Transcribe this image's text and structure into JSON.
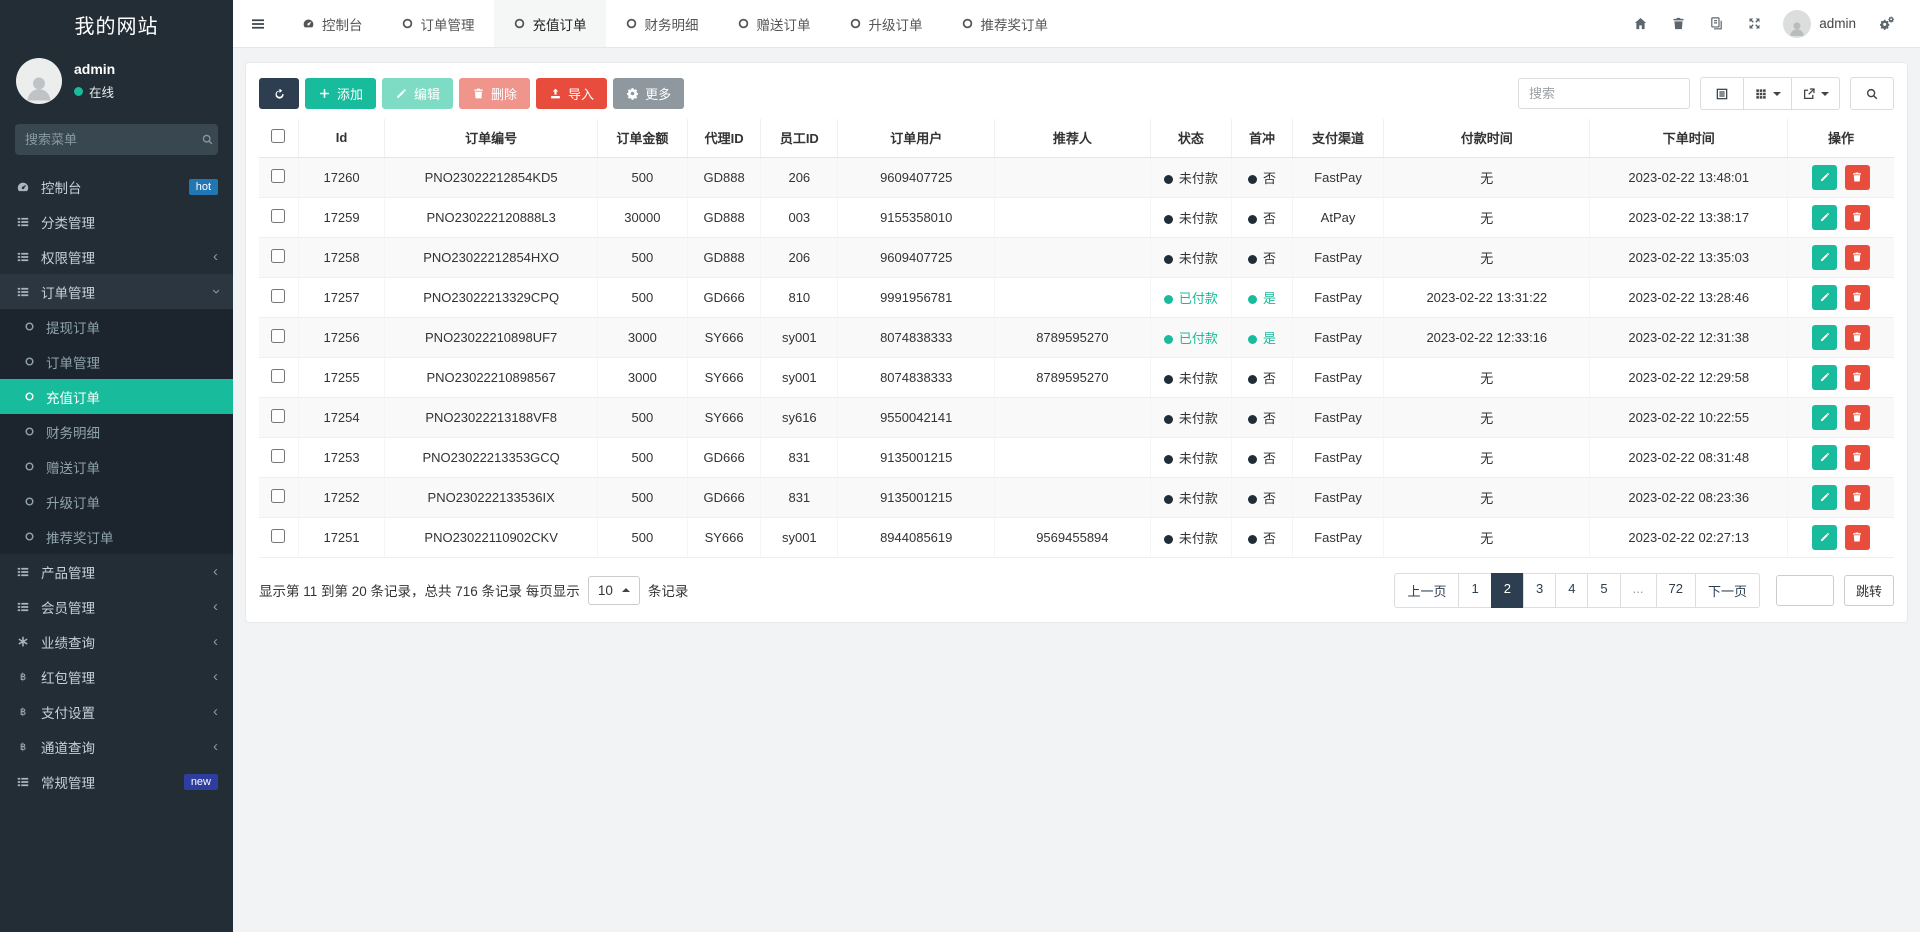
{
  "app": {
    "title": "我的网站"
  },
  "sidebar": {
    "user": {
      "name": "admin",
      "status": "在线"
    },
    "search_placeholder": "搜索菜单",
    "items": [
      {
        "label": "控制台",
        "icon": "gauge",
        "badge": "hot"
      },
      {
        "label": "分类管理",
        "icon": "list"
      },
      {
        "label": "权限管理",
        "icon": "list",
        "chevron": "left"
      },
      {
        "label": "订单管理",
        "icon": "list",
        "chevron": "down",
        "expanded": true,
        "children": [
          {
            "label": "提现订单"
          },
          {
            "label": "订单管理"
          },
          {
            "label": "充值订单",
            "active": true
          },
          {
            "label": "财务明细"
          },
          {
            "label": "赠送订单"
          },
          {
            "label": "升级订单"
          },
          {
            "label": "推荐奖订单"
          }
        ]
      },
      {
        "label": "产品管理",
        "icon": "list",
        "chevron": "left"
      },
      {
        "label": "会员管理",
        "icon": "list",
        "chevron": "left"
      },
      {
        "label": "业绩查询",
        "icon": "asterisk",
        "chevron": "left"
      },
      {
        "label": "红包管理",
        "icon": "baht",
        "chevron": "left"
      },
      {
        "label": "支付设置",
        "icon": "baht",
        "chevron": "left"
      },
      {
        "label": "通道查询",
        "icon": "baht",
        "chevron": "left"
      },
      {
        "label": "常规管理",
        "icon": "list",
        "badge": "new"
      }
    ]
  },
  "topnav": {
    "tabs": [
      {
        "label": "控制台",
        "icon": "gauge"
      },
      {
        "label": "订单管理",
        "icon": "ring"
      },
      {
        "label": "充值订单",
        "icon": "ring",
        "active": true
      },
      {
        "label": "财务明细",
        "icon": "ring"
      },
      {
        "label": "赠送订单",
        "icon": "ring"
      },
      {
        "label": "升级订单",
        "icon": "ring"
      },
      {
        "label": "推荐奖订单",
        "icon": "ring"
      }
    ],
    "right_icons": [
      {
        "name": "home-icon",
        "icon": "home"
      },
      {
        "name": "trash-icon",
        "icon": "trash"
      },
      {
        "name": "copy-icon",
        "icon": "copy"
      },
      {
        "name": "fullscreen-icon",
        "icon": "expand"
      }
    ],
    "user": "admin"
  },
  "toolbar": {
    "buttons": [
      {
        "label": "",
        "icon": "refresh",
        "variant": "dark",
        "name": "refresh-button"
      },
      {
        "label": "添加",
        "icon": "plus",
        "variant": "success",
        "name": "add-button"
      },
      {
        "label": "编辑",
        "icon": "pencil",
        "variant": "success-muted",
        "name": "edit-button"
      },
      {
        "label": "删除",
        "icon": "trash",
        "variant": "danger-muted",
        "name": "delete-button"
      },
      {
        "label": "导入",
        "icon": "upload",
        "variant": "danger",
        "name": "import-button"
      },
      {
        "label": "更多",
        "icon": "gear",
        "variant": "secondary",
        "name": "more-button"
      }
    ],
    "search_placeholder": "搜索",
    "view_buttons": [
      {
        "name": "toggle-view-button",
        "icon": "listview"
      },
      {
        "name": "columns-button",
        "icon": "grid",
        "caret": true
      },
      {
        "name": "export-button",
        "icon": "export",
        "caret": true
      }
    ]
  },
  "table": {
    "headers": [
      "Id",
      "订单编号",
      "订单金额",
      "代理ID",
      "员工ID",
      "订单用户",
      "推荐人",
      "状态",
      "首冲",
      "支付渠道",
      "付款时间",
      "下单时间",
      "操作"
    ],
    "rows": [
      {
        "id": "17260",
        "order_no": "PNO23022212854KD5",
        "amount": "500",
        "agent_id": "GD888",
        "staff_id": "206",
        "order_user": "9609407725",
        "referrer": "",
        "status": "未付款",
        "first_charge": "否",
        "channel": "FastPay",
        "pay_time": "无",
        "order_time": "2023-02-22 13:48:01"
      },
      {
        "id": "17259",
        "order_no": "PNO230222120888L3",
        "amount": "30000",
        "agent_id": "GD888",
        "staff_id": "003",
        "order_user": "9155358010",
        "referrer": "",
        "status": "未付款",
        "first_charge": "否",
        "channel": "AtPay",
        "pay_time": "无",
        "order_time": "2023-02-22 13:38:17"
      },
      {
        "id": "17258",
        "order_no": "PNO23022212854HXO",
        "amount": "500",
        "agent_id": "GD888",
        "staff_id": "206",
        "order_user": "9609407725",
        "referrer": "",
        "status": "未付款",
        "first_charge": "否",
        "channel": "FastPay",
        "pay_time": "无",
        "order_time": "2023-02-22 13:35:03"
      },
      {
        "id": "17257",
        "order_no": "PNO23022213329CPQ",
        "amount": "500",
        "agent_id": "GD666",
        "staff_id": "810",
        "order_user": "9991956781",
        "referrer": "",
        "status": "已付款",
        "first_charge": "是",
        "channel": "FastPay",
        "pay_time": "2023-02-22 13:31:22",
        "order_time": "2023-02-22 13:28:46"
      },
      {
        "id": "17256",
        "order_no": "PNO23022210898UF7",
        "amount": "3000",
        "agent_id": "SY666",
        "staff_id": "sy001",
        "order_user": "8074838333",
        "referrer": "8789595270",
        "status": "已付款",
        "first_charge": "是",
        "channel": "FastPay",
        "pay_time": "2023-02-22 12:33:16",
        "order_time": "2023-02-22 12:31:38"
      },
      {
        "id": "17255",
        "order_no": "PNO23022210898567",
        "amount": "3000",
        "agent_id": "SY666",
        "staff_id": "sy001",
        "order_user": "8074838333",
        "referrer": "8789595270",
        "status": "未付款",
        "first_charge": "否",
        "channel": "FastPay",
        "pay_time": "无",
        "order_time": "2023-02-22 12:29:58"
      },
      {
        "id": "17254",
        "order_no": "PNO23022213188VF8",
        "amount": "500",
        "agent_id": "SY666",
        "staff_id": "sy616",
        "order_user": "9550042141",
        "referrer": "",
        "status": "未付款",
        "first_charge": "否",
        "channel": "FastPay",
        "pay_time": "无",
        "order_time": "2023-02-22 10:22:55"
      },
      {
        "id": "17253",
        "order_no": "PNO23022213353GCQ",
        "amount": "500",
        "agent_id": "GD666",
        "staff_id": "831",
        "order_user": "9135001215",
        "referrer": "",
        "status": "未付款",
        "first_charge": "否",
        "channel": "FastPay",
        "pay_time": "无",
        "order_time": "2023-02-22 08:31:48"
      },
      {
        "id": "17252",
        "order_no": "PNO230222133536IX",
        "amount": "500",
        "agent_id": "GD666",
        "staff_id": "831",
        "order_user": "9135001215",
        "referrer": "",
        "status": "未付款",
        "first_charge": "否",
        "channel": "FastPay",
        "pay_time": "无",
        "order_time": "2023-02-22 08:23:36"
      },
      {
        "id": "17251",
        "order_no": "PNO23022110902CKV",
        "amount": "500",
        "agent_id": "SY666",
        "staff_id": "sy001",
        "order_user": "8944085619",
        "referrer": "9569455894",
        "status": "未付款",
        "first_charge": "否",
        "channel": "FastPay",
        "pay_time": "无",
        "order_time": "2023-02-22 02:27:13"
      }
    ]
  },
  "footer": {
    "info_prefix": "显示第 11 到第 20 条记录，总共 716 条记录 每页显示",
    "page_size": "10",
    "info_suffix": "条记录",
    "pages": [
      {
        "label": "上一页"
      },
      {
        "label": "1"
      },
      {
        "label": "2",
        "active": true
      },
      {
        "label": "3"
      },
      {
        "label": "4"
      },
      {
        "label": "5"
      },
      {
        "label": "...",
        "disabled": true
      },
      {
        "label": "72"
      },
      {
        "label": "下一页"
      }
    ],
    "jump_value": "",
    "jump_label": "跳转"
  },
  "colors": {
    "accent": "#18bc9c",
    "navy": "#2c3e50",
    "danger": "#e74c3c",
    "sidebar_bg": "#222d36",
    "hot_badge": "#2077b4",
    "new_badge": "#2f3d9e"
  }
}
